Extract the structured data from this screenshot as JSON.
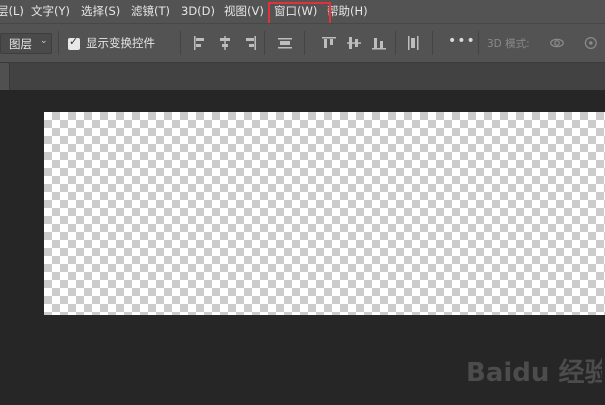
{
  "menu": {
    "items": [
      {
        "label": "层(L)"
      },
      {
        "label": "文字(Y)"
      },
      {
        "label": "选择(S)"
      },
      {
        "label": "滤镜(T)"
      },
      {
        "label": "3D(D)"
      },
      {
        "label": "视图(V)"
      },
      {
        "label": "窗口(W)"
      },
      {
        "label": "帮助(H)"
      }
    ],
    "highlighted": "窗口(W)",
    "highlight_color": "#e2313b"
  },
  "options": {
    "layer_select": "图层",
    "checkbox_label": "显示变换控件",
    "checkbox_checked": true,
    "mode_3d_label": "3D 模式:"
  },
  "watermark": {
    "text": "Baidu 经验"
  }
}
